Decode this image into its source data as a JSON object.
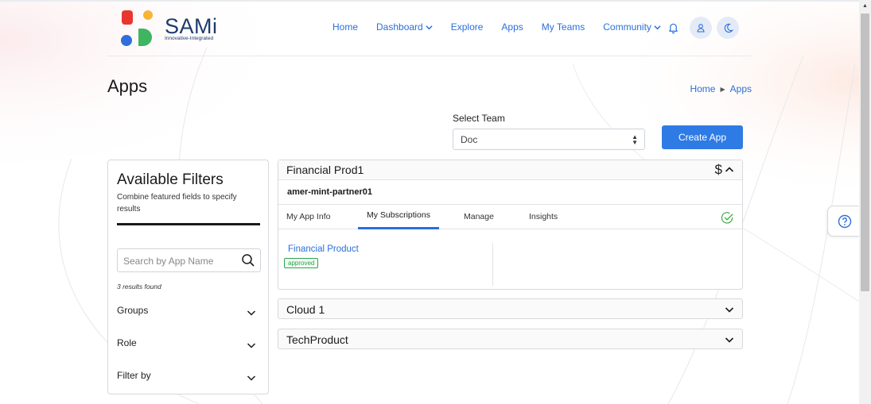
{
  "brand": {
    "name": "SAMi",
    "tagline": "Innovative-Integrated"
  },
  "nav": {
    "items": [
      {
        "label": "Home"
      },
      {
        "label": "Dashboard",
        "dropdown": true
      },
      {
        "label": "Explore"
      },
      {
        "label": "Apps"
      },
      {
        "label": "My Teams"
      },
      {
        "label": "Community",
        "dropdown": true
      }
    ],
    "icons": [
      "bell-icon",
      "user-icon",
      "moon-icon"
    ]
  },
  "page": {
    "title": "Apps"
  },
  "breadcrumb": {
    "home": "Home",
    "current": "Apps"
  },
  "team_select": {
    "label": "Select Team",
    "value": "Doc"
  },
  "create_button": "Create App",
  "filters": {
    "title": "Available Filters",
    "subtitle": "Combine featured fields to specify results",
    "search_placeholder": "Search by App Name",
    "results": "3 results found",
    "groups": [
      {
        "label": "Groups"
      },
      {
        "label": "Role"
      },
      {
        "label": "Filter by"
      }
    ]
  },
  "apps": [
    {
      "name": "Financial Prod1",
      "expanded": true,
      "partner": "amer-mint-partner01",
      "tabs": [
        "My App Info",
        "My Subscriptions",
        "Manage",
        "Insights"
      ],
      "active_tab": "My Subscriptions",
      "subscription": {
        "product": "Financial Product",
        "status": "approved"
      }
    },
    {
      "name": "Cloud 1",
      "expanded": false
    },
    {
      "name": "TechProduct",
      "expanded": false
    }
  ],
  "colors": {
    "accent": "#2a6fdb",
    "button": "#2f7be5",
    "status_green": "#2ea44f",
    "brand_navy": "#1f3b6e"
  }
}
